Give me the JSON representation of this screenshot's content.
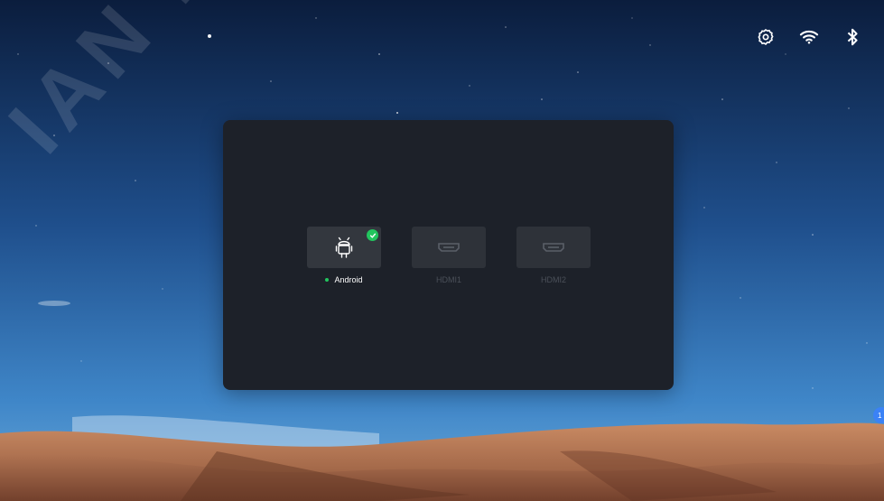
{
  "watermark": "IAN NOVA",
  "status_bar": {
    "icons": [
      "gear-icon",
      "wifi-icon",
      "bluetooth-icon"
    ]
  },
  "sources": [
    {
      "label": "Android",
      "icon": "android-icon",
      "selected": true
    },
    {
      "label": "HDMI1",
      "icon": "hdmi-port-icon",
      "selected": false
    },
    {
      "label": "HDMI2",
      "icon": "hdmi-port-icon",
      "selected": false
    }
  ],
  "notification": {
    "count": "1"
  },
  "colors": {
    "accent": "#22c55e",
    "panel": "#1d2129",
    "card": "#33373e"
  }
}
